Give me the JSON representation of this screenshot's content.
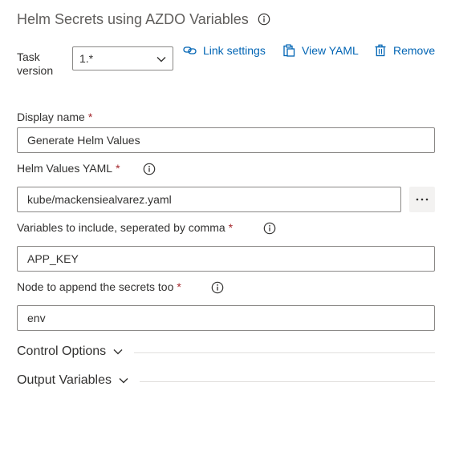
{
  "header": {
    "title": "Helm Secrets using AZDO Variables"
  },
  "task_version": {
    "label": "Task version",
    "value": "1.*"
  },
  "actions": {
    "link_settings": "Link settings",
    "view_yaml": "View YAML",
    "remove": "Remove"
  },
  "fields": {
    "display_name": {
      "label": "Display name",
      "required_mark": "*",
      "value": "Generate Helm Values"
    },
    "helm_values_yaml": {
      "label": "Helm Values YAML",
      "required_mark": "*",
      "value": "kube/mackensiealvarez.yaml",
      "more_button": "⋯"
    },
    "variables_to_include": {
      "label": "Variables to include, seperated by comma",
      "required_mark": "*",
      "value": "APP_KEY"
    },
    "node_to_append": {
      "label": "Node to append the secrets too",
      "required_mark": "*",
      "value": "env"
    }
  },
  "sections": {
    "control_options": "Control Options",
    "output_variables": "Output Variables"
  },
  "colors": {
    "link": "#0064b4",
    "required": "#a4262c",
    "border": "#8a8886",
    "text": "#323130"
  },
  "icons": {
    "info": "info-icon",
    "chevron": "chevron-down-icon",
    "link": "link-icon",
    "clipboard": "clipboard-icon",
    "trash": "trash-icon"
  }
}
